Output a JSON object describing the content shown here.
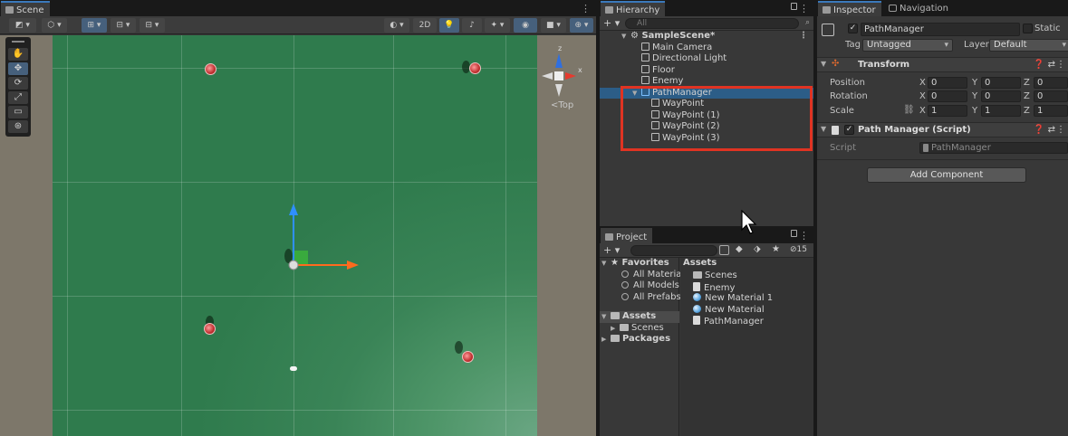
{
  "scene": {
    "tab_label": "Scene",
    "toolbar": {
      "mode_2d": "2D"
    },
    "gizmo": {
      "z_label": "z",
      "x_label": "x",
      "view_label": "Top"
    },
    "tools": [
      "hand-tool",
      "move-tool",
      "rotate-tool",
      "scale-tool",
      "rect-tool",
      "transform-tool"
    ]
  },
  "hierarchy": {
    "tab_label": "Hierarchy",
    "search_placeholder": "All",
    "add_label": "+",
    "items": [
      {
        "label": "SampleScene*"
      },
      {
        "label": "Main Camera"
      },
      {
        "label": "Directional Light"
      },
      {
        "label": "Floor"
      },
      {
        "label": "Enemy"
      },
      {
        "label": "PathManager"
      },
      {
        "label": "WayPoint"
      },
      {
        "label": "WayPoint (1)"
      },
      {
        "label": "WayPoint (2)"
      },
      {
        "label": "WayPoint (3)"
      }
    ]
  },
  "project": {
    "tab_label": "Project",
    "add_label": "+",
    "hidden_count": "15",
    "left": [
      {
        "label": "Favorites"
      },
      {
        "label": "All Materials"
      },
      {
        "label": "All Models"
      },
      {
        "label": "All Prefabs"
      },
      {
        "label": "Assets"
      },
      {
        "label": "Scenes"
      },
      {
        "label": "Packages"
      }
    ],
    "assets_header": "Assets",
    "assets": [
      {
        "label": "Scenes",
        "kind": "folder"
      },
      {
        "label": "Enemy",
        "kind": "script"
      },
      {
        "label": "New Material 1",
        "kind": "material"
      },
      {
        "label": "New Material",
        "kind": "material"
      },
      {
        "label": "PathManager",
        "kind": "script"
      }
    ]
  },
  "inspector": {
    "tab_label": "Inspector",
    "nav_tab_label": "Navigation",
    "object_name": "PathManager",
    "static_label": "Static",
    "tag_label": "Tag",
    "tag_value": "Untagged",
    "layer_label": "Layer",
    "layer_value": "Default",
    "transform": {
      "title": "Transform",
      "position_label": "Position",
      "rotation_label": "Rotation",
      "scale_label": "Scale",
      "position": {
        "x": "0",
        "y": "0",
        "z": "0"
      },
      "rotation": {
        "x": "0",
        "y": "0",
        "z": "0"
      },
      "scale": {
        "x": "1",
        "y": "1",
        "z": "1"
      },
      "axis_x": "X",
      "axis_y": "Y",
      "axis_z": "Z"
    },
    "script_component": {
      "title": "Path Manager (Script)",
      "script_label": "Script",
      "script_value": "PathManager"
    },
    "add_component_label": "Add Component"
  },
  "colors": {
    "selection": "#2c5d87",
    "highlight_box": "#e03322",
    "floor": "#3a8457"
  }
}
